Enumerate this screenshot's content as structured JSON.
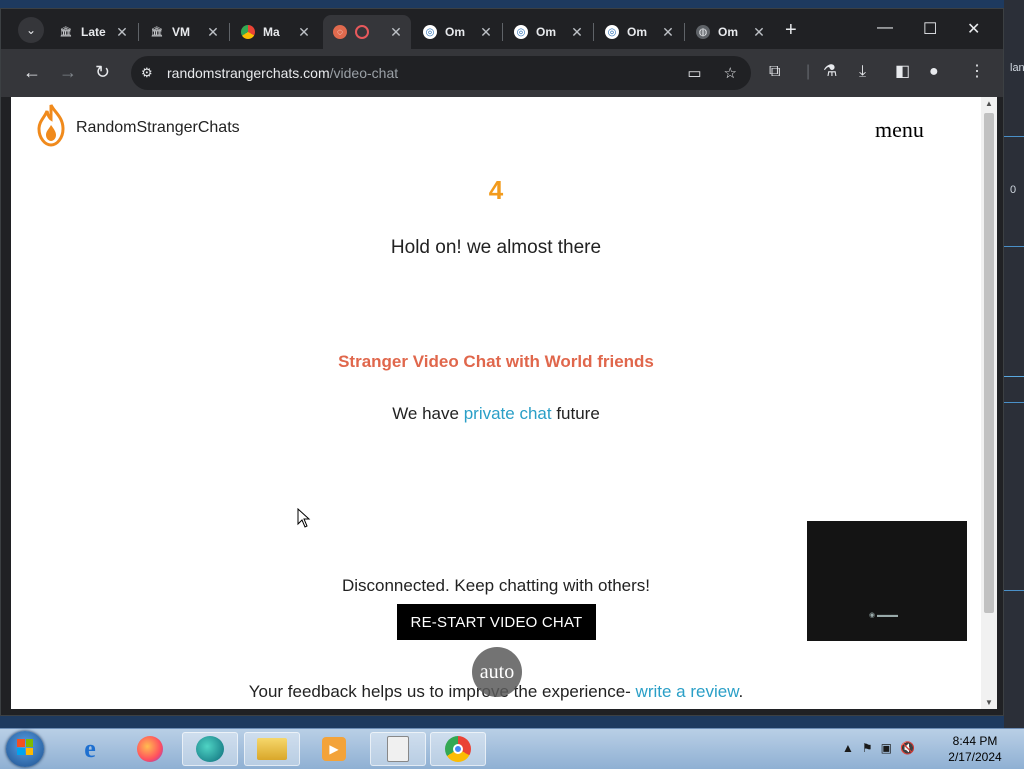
{
  "desktop": {
    "right_glimpse_text": [
      "lan",
      "0"
    ]
  },
  "browser": {
    "tabs": [
      {
        "title": "Late",
        "icon": "building-icon"
      },
      {
        "title": "VM",
        "icon": "building-icon"
      },
      {
        "title": "Ma",
        "icon": "chrome-app-icon"
      },
      {
        "title": "",
        "icon": "recording-icon",
        "active": true
      },
      {
        "title": "Om",
        "icon": "omegle-icon"
      },
      {
        "title": "Om",
        "icon": "omegle-icon"
      },
      {
        "title": "Om",
        "icon": "omegle-icon"
      },
      {
        "title": "Om",
        "icon": "globe-icon"
      }
    ],
    "url_host": "randomstrangerchats.com",
    "url_path": "/video-chat"
  },
  "page": {
    "brand": "RandomStrangerChats",
    "menu_label": "menu",
    "countdown": "4",
    "hold_on": "Hold on! we almost there",
    "headline": "Stranger Video Chat with World friends",
    "private_prefix": "We have ",
    "private_link": "private chat",
    "private_suffix": " future",
    "disconnected": "Disconnected. Keep chatting with others!",
    "restart_button": "RE-START VIDEO CHAT",
    "auto_label": "auto",
    "feedback_prefix": "Your feedback helps us to improve the experience- ",
    "feedback_link": "write a review",
    "feedback_suffix": "."
  },
  "taskbar": {
    "clock_time": "8:44 PM",
    "clock_date": "2/17/2024"
  }
}
